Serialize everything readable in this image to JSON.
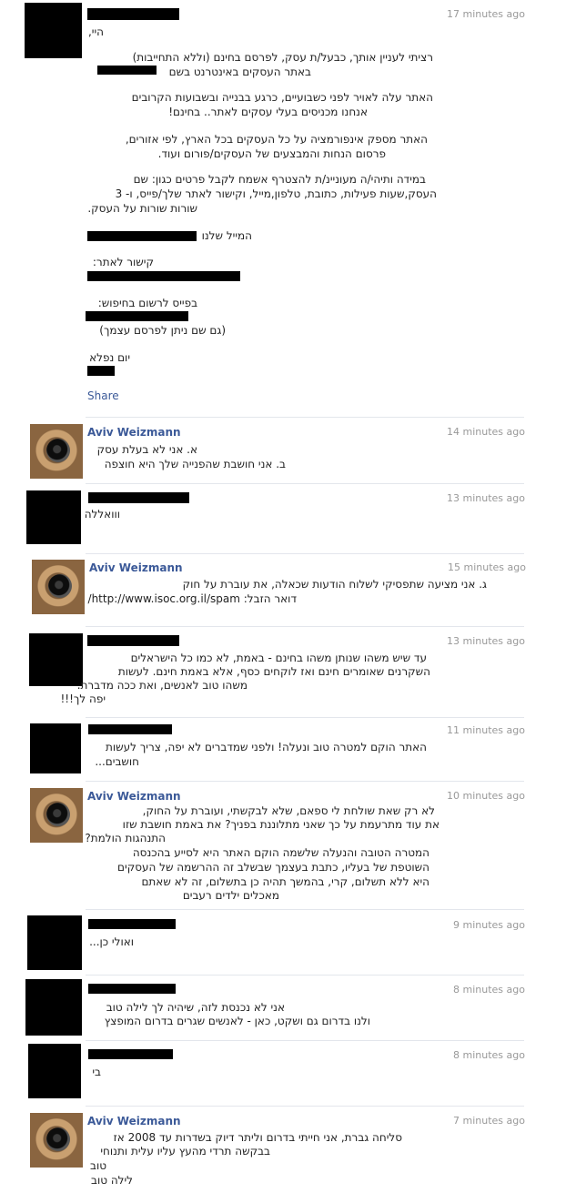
{
  "posts": [
    {
      "time": "17 minutes ago",
      "lines": [
        "היי,",
        "רציתי לעניין אותך, כבעל/ת עסק, לפרסם בחינם (וללא התחייבות)",
        "באתר העסקים באינטרנט בשם",
        "האתר עלה לאויר לפני כשבועיים, כרגע בבנייה ובשבועות הקרובים",
        "אנחנו מכניסים בעלי עסקים לאתר.. בחינם!",
        "האתר מספק אינפורמציה על כל העסקים בכל הארץ, לפי אזורים,",
        "פרסום הנחות והמבצעים של העסקים/פורום ועוד.",
        "במידה ותיהי/ה מעוניינ/ת להצטרף אשמח לקבל פרטים כגון: שם",
        "העסק,שעות פעילות, כתובת, טלפון,מייל, וקישור לאתר שלך/פייס, ו- 3",
        "שורות שורות על העסק.",
        "המייל שלנו",
        "קישור לאתר:",
        "בפייס לרשום בחיפוש:",
        "(גם שם ניתן לפרסם עצמך)",
        "יום נפלא"
      ],
      "share": "Share"
    },
    {
      "name": "Aviv Weizmann",
      "time": "14 minutes ago",
      "lines": [
        "א. אני לא בעלת עסק",
        "ב. אני חושבת שהפנייה שלך היא חוצפה"
      ]
    },
    {
      "time": "13 minutes ago",
      "lines": [
        "ווואללה"
      ]
    },
    {
      "name": "Aviv Weizmann",
      "time": "15 minutes ago",
      "lines": [
        "ג. אני מציעה שתפסיקי לשלוח הודעות שכאלה, את עוברת על חוק",
        "דואר הזבל: http://www.isoc.org.il/spam/"
      ]
    },
    {
      "time": "13 minutes ago",
      "lines": [
        "עד שיש משהו שנותן משהו בחינם - באמת, לא כמו כל הישראלים",
        "השקרנים שאומרים חינם ואז לוקחים כסף, אלא באמת חינם. לעשות",
        "משהו טוב לאנשים, ואת ככה מדברת.",
        "יפה לך!!!"
      ]
    },
    {
      "time": "11 minutes ago",
      "lines": [
        "האתר הוקם למטרה טוב ונעלה! ולפני שמדברים לא יפה, צריך לעשות",
        "חושבים..."
      ]
    },
    {
      "name": "Aviv Weizmann",
      "time": "10 minutes ago",
      "lines": [
        "לא רק שאת שולחת לי ספאם, שלא לבקשתי, ועוברת על החוק,",
        "את עוד מתרעמת על כך שאני מתלוננת בפניך? את באמת חושבת שזו",
        "התנהגות הולמת?",
        "המטרה הטובה והנעלה שלשמה הוקם האתר היא לסייע בהכנסה",
        "השוטפת של בעליו, כתבת בעצמך שבשלב זה ההרשמה של העסקים",
        "היא ללא תשלום, קרי, בהמשך תהיה כן בתשלום, זה לא שאתם",
        "מאכלים ילדים רעבים"
      ]
    },
    {
      "time": "9 minutes ago",
      "lines": [
        "ואולי כן..."
      ]
    },
    {
      "time": "8 minutes ago",
      "lines": [
        "אני לא נכנסת לזה, שיהיה לך לילה טוב",
        "ולנו בדרום גם ושקט, כאן - לאנשים שגרים בדרום המופצץ"
      ]
    },
    {
      "time": "8 minutes ago",
      "lines": [
        "בי"
      ]
    },
    {
      "name": "Aviv Weizmann",
      "time": "7 minutes ago",
      "lines": [
        "סליחה גברת, אני חייתי בדרום וליתר דיוק בשדרות עד 2008 אז",
        "בבקשה תרדי מהעץ עליו עלית ותנוחי",
        "טוב",
        "לילה טוב"
      ]
    }
  ]
}
